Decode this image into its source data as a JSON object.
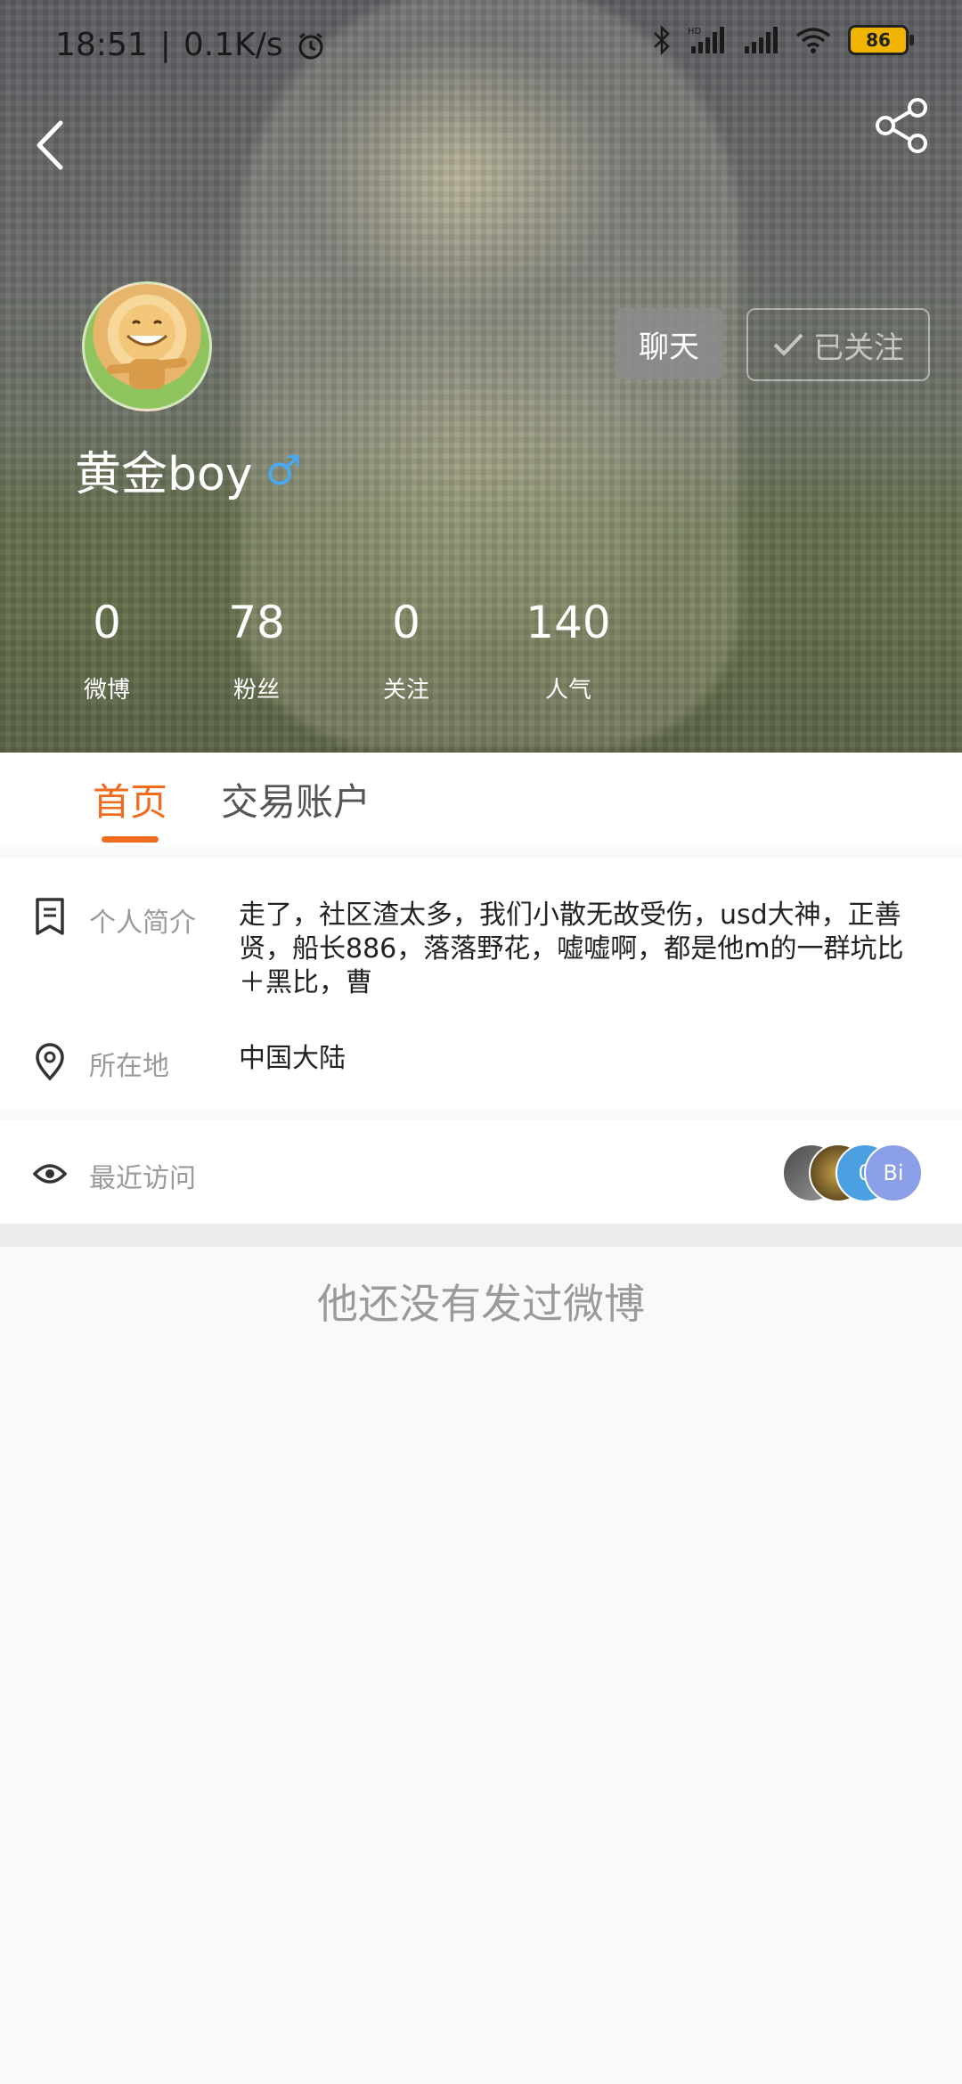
{
  "status_bar": {
    "time": "18:51",
    "separator": "|",
    "net_speed": "0.1K/s",
    "battery": "86"
  },
  "profile": {
    "username": "黄金boy",
    "gender_symbol": "♂",
    "chat_label": "聊天",
    "follow_label": "已关注",
    "stats": [
      {
        "value": "0",
        "label": "微博"
      },
      {
        "value": "78",
        "label": "粉丝"
      },
      {
        "value": "0",
        "label": "关注"
      },
      {
        "value": "140",
        "label": "人气"
      }
    ]
  },
  "tabs": {
    "home": "首页",
    "trade": "交易账户"
  },
  "info": {
    "bio_label": "个人简介",
    "bio_value": "走了，社区渣太多，我们小散无故受伤，usd大神，正善贤，船长886，落落野花，嘘嘘啊，都是他m的一群坑比＋黑比，曹",
    "location_label": "所在地",
    "location_value": "中国大陆"
  },
  "recent_visits": {
    "label": "最近访问",
    "avatars": [
      "",
      "",
      "0",
      "Bi"
    ]
  },
  "empty_state": "他还没有发过微博",
  "colors": {
    "accent": "#f26a1b",
    "gender": "#4aa8f0"
  }
}
